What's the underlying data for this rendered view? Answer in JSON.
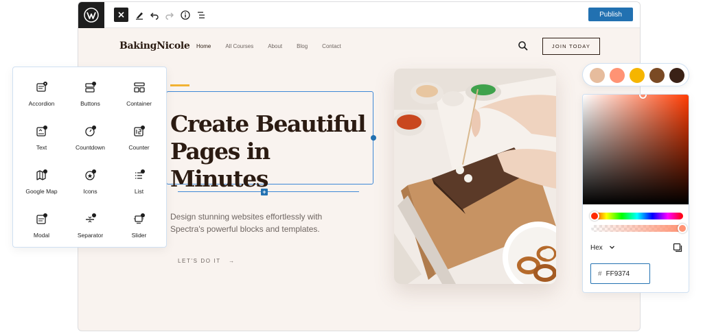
{
  "toolbar": {
    "publish_label": "Publish"
  },
  "site": {
    "brand": "BakingNicole",
    "nav": [
      "Home",
      "All Courses",
      "About",
      "Blog",
      "Contact"
    ],
    "active_nav": "Home",
    "join_label": "JOIN TODAY"
  },
  "hero": {
    "title_line1": "Create Beautiful",
    "title_line2": "Pages in Minutes",
    "description": "Design stunning websites effortlessly with Spectra's powerful blocks and templates.",
    "cta_label": "LET'S DO IT",
    "cta_arrow": "→"
  },
  "blocks": {
    "items": [
      {
        "label": "Accordion",
        "icon": "accordion-icon"
      },
      {
        "label": "Buttons",
        "icon": "buttons-icon"
      },
      {
        "label": "Container",
        "icon": "container-icon"
      },
      {
        "label": "Text",
        "icon": "text-icon"
      },
      {
        "label": "Countdown",
        "icon": "countdown-icon"
      },
      {
        "label": "Counter",
        "icon": "counter-icon"
      },
      {
        "label": "Google Map",
        "icon": "map-icon"
      },
      {
        "label": "Icons",
        "icon": "icons-icon"
      },
      {
        "label": "List",
        "icon": "list-icon"
      },
      {
        "label": "Modal",
        "icon": "modal-icon"
      },
      {
        "label": "Separator",
        "icon": "separator-icon"
      },
      {
        "label": "Slider",
        "icon": "slider-icon"
      }
    ]
  },
  "swatches": [
    "#e6bc9d",
    "#ff9374",
    "#f6b500",
    "#7a4a24",
    "#3a2116"
  ],
  "picker": {
    "format_label": "Hex",
    "hex_prefix": "#",
    "hex_value": "FF9374",
    "hue_color": "#ff3a00"
  },
  "colors": {
    "accent": "#2271b1",
    "heading": "#2b1b12",
    "page_bg": "#f9f3ef"
  }
}
